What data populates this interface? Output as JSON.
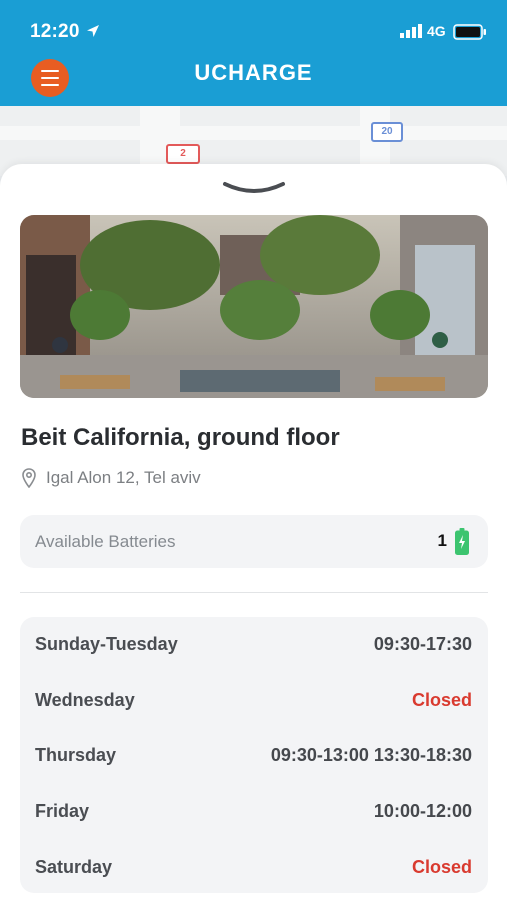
{
  "status_bar": {
    "time": "12:20",
    "network": "4G"
  },
  "header": {
    "title": "UCHARGE"
  },
  "map": {
    "sign_left": "2",
    "sign_right": "20"
  },
  "location": {
    "title": "Beit California, ground floor",
    "address": "Igal Alon 12, Tel aviv"
  },
  "batteries": {
    "label": "Available Batteries",
    "count": "1"
  },
  "hours": [
    {
      "day": "Sunday-Tuesday",
      "time": "09:30-17:30",
      "closed": false
    },
    {
      "day": "Wednesday",
      "time": "Closed",
      "closed": true
    },
    {
      "day": "Thursday",
      "time": "09:30-13:00 13:30-18:30",
      "closed": false
    },
    {
      "day": "Friday",
      "time": "10:00-12:00",
      "closed": false
    },
    {
      "day": "Saturday",
      "time": "Closed",
      "closed": true
    }
  ],
  "colors": {
    "header": "#1a9ed4",
    "menu_button": "#e85d22",
    "closed": "#d93a2f",
    "battery_icon": "#3cc46f"
  },
  "icons": [
    "menu-icon",
    "location-arrow-icon",
    "signal-icon",
    "battery-icon",
    "handle-chevron-icon",
    "map-pin-icon",
    "battery-charging-icon"
  ]
}
